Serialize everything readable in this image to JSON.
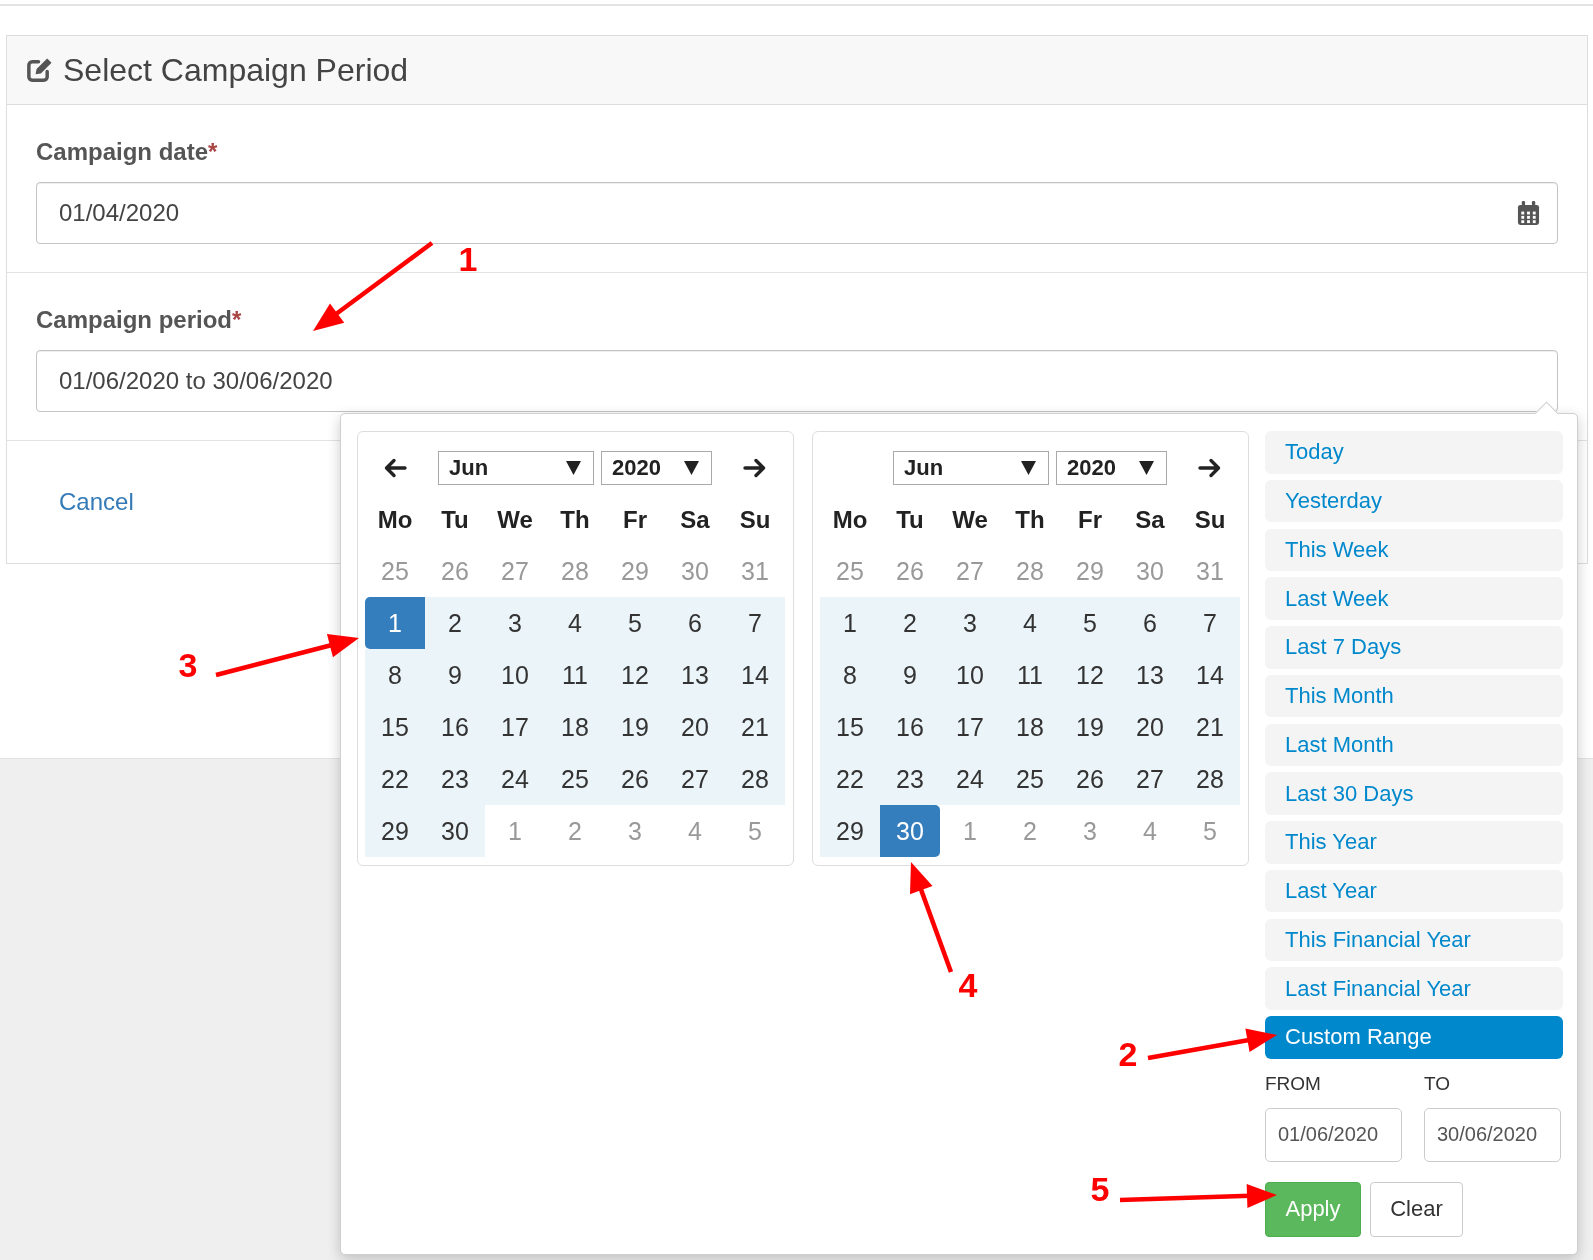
{
  "panel": {
    "title": "Select Campaign Period",
    "fields": [
      {
        "label": "Campaign date",
        "required_mark": "*",
        "value": "01/04/2020",
        "calendar_icon": true
      },
      {
        "label": "Campaign period",
        "required_mark": "*",
        "value": "01/06/2020 to 30/06/2020",
        "calendar_icon": false
      }
    ],
    "cancel": "Cancel"
  },
  "date_range_picker": {
    "calendars": [
      {
        "month": "Jun",
        "year": "2020",
        "show_previous": true,
        "show_next": true,
        "weekdays": [
          "Mo",
          "Tu",
          "We",
          "Th",
          "Fr",
          "Sa",
          "Su"
        ],
        "days": [
          {
            "day": "25",
            "off": true,
            "in_range": false,
            "selected": false
          },
          {
            "day": "26",
            "off": true,
            "in_range": false,
            "selected": false
          },
          {
            "day": "27",
            "off": true,
            "in_range": false,
            "selected": false
          },
          {
            "day": "28",
            "off": true,
            "in_range": false,
            "selected": false
          },
          {
            "day": "29",
            "off": true,
            "in_range": false,
            "selected": false
          },
          {
            "day": "30",
            "off": true,
            "in_range": false,
            "selected": false
          },
          {
            "day": "31",
            "off": true,
            "in_range": false,
            "selected": false
          },
          {
            "day": "1",
            "off": false,
            "in_range": true,
            "selected": true
          },
          {
            "day": "2",
            "off": false,
            "in_range": true,
            "selected": false
          },
          {
            "day": "3",
            "off": false,
            "in_range": true,
            "selected": false
          },
          {
            "day": "4",
            "off": false,
            "in_range": true,
            "selected": false
          },
          {
            "day": "5",
            "off": false,
            "in_range": true,
            "selected": false
          },
          {
            "day": "6",
            "off": false,
            "in_range": true,
            "selected": false
          },
          {
            "day": "7",
            "off": false,
            "in_range": true,
            "selected": false
          },
          {
            "day": "8",
            "off": false,
            "in_range": true,
            "selected": false
          },
          {
            "day": "9",
            "off": false,
            "in_range": true,
            "selected": false
          },
          {
            "day": "10",
            "off": false,
            "in_range": true,
            "selected": false
          },
          {
            "day": "11",
            "off": false,
            "in_range": true,
            "selected": false
          },
          {
            "day": "12",
            "off": false,
            "in_range": true,
            "selected": false
          },
          {
            "day": "13",
            "off": false,
            "in_range": true,
            "selected": false
          },
          {
            "day": "14",
            "off": false,
            "in_range": true,
            "selected": false
          },
          {
            "day": "15",
            "off": false,
            "in_range": true,
            "selected": false
          },
          {
            "day": "16",
            "off": false,
            "in_range": true,
            "selected": false
          },
          {
            "day": "17",
            "off": false,
            "in_range": true,
            "selected": false
          },
          {
            "day": "18",
            "off": false,
            "in_range": true,
            "selected": false
          },
          {
            "day": "19",
            "off": false,
            "in_range": true,
            "selected": false
          },
          {
            "day": "20",
            "off": false,
            "in_range": true,
            "selected": false
          },
          {
            "day": "21",
            "off": false,
            "in_range": true,
            "selected": false
          },
          {
            "day": "22",
            "off": false,
            "in_range": true,
            "selected": false
          },
          {
            "day": "23",
            "off": false,
            "in_range": true,
            "selected": false
          },
          {
            "day": "24",
            "off": false,
            "in_range": true,
            "selected": false
          },
          {
            "day": "25",
            "off": false,
            "in_range": true,
            "selected": false
          },
          {
            "day": "26",
            "off": false,
            "in_range": true,
            "selected": false
          },
          {
            "day": "27",
            "off": false,
            "in_range": true,
            "selected": false
          },
          {
            "day": "28",
            "off": false,
            "in_range": true,
            "selected": false
          },
          {
            "day": "29",
            "off": false,
            "in_range": true,
            "selected": false
          },
          {
            "day": "30",
            "off": false,
            "in_range": true,
            "selected": false
          },
          {
            "day": "1",
            "off": true,
            "in_range": false,
            "selected": false
          },
          {
            "day": "2",
            "off": true,
            "in_range": false,
            "selected": false
          },
          {
            "day": "3",
            "off": true,
            "in_range": false,
            "selected": false
          },
          {
            "day": "4",
            "off": true,
            "in_range": false,
            "selected": false
          },
          {
            "day": "5",
            "off": true,
            "in_range": false,
            "selected": false
          }
        ]
      },
      {
        "month": "Jun",
        "year": "2020",
        "show_previous": false,
        "show_next": true,
        "weekdays": [
          "Mo",
          "Tu",
          "We",
          "Th",
          "Fr",
          "Sa",
          "Su"
        ],
        "days": [
          {
            "day": "25",
            "off": true,
            "in_range": false,
            "selected": false
          },
          {
            "day": "26",
            "off": true,
            "in_range": false,
            "selected": false
          },
          {
            "day": "27",
            "off": true,
            "in_range": false,
            "selected": false
          },
          {
            "day": "28",
            "off": true,
            "in_range": false,
            "selected": false
          },
          {
            "day": "29",
            "off": true,
            "in_range": false,
            "selected": false
          },
          {
            "day": "30",
            "off": true,
            "in_range": false,
            "selected": false
          },
          {
            "day": "31",
            "off": true,
            "in_range": false,
            "selected": false
          },
          {
            "day": "1",
            "off": false,
            "in_range": true,
            "selected": false
          },
          {
            "day": "2",
            "off": false,
            "in_range": true,
            "selected": false
          },
          {
            "day": "3",
            "off": false,
            "in_range": true,
            "selected": false
          },
          {
            "day": "4",
            "off": false,
            "in_range": true,
            "selected": false
          },
          {
            "day": "5",
            "off": false,
            "in_range": true,
            "selected": false
          },
          {
            "day": "6",
            "off": false,
            "in_range": true,
            "selected": false
          },
          {
            "day": "7",
            "off": false,
            "in_range": true,
            "selected": false
          },
          {
            "day": "8",
            "off": false,
            "in_range": true,
            "selected": false
          },
          {
            "day": "9",
            "off": false,
            "in_range": true,
            "selected": false
          },
          {
            "day": "10",
            "off": false,
            "in_range": true,
            "selected": false
          },
          {
            "day": "11",
            "off": false,
            "in_range": true,
            "selected": false
          },
          {
            "day": "12",
            "off": false,
            "in_range": true,
            "selected": false
          },
          {
            "day": "13",
            "off": false,
            "in_range": true,
            "selected": false
          },
          {
            "day": "14",
            "off": false,
            "in_range": true,
            "selected": false
          },
          {
            "day": "15",
            "off": false,
            "in_range": true,
            "selected": false
          },
          {
            "day": "16",
            "off": false,
            "in_range": true,
            "selected": false
          },
          {
            "day": "17",
            "off": false,
            "in_range": true,
            "selected": false
          },
          {
            "day": "18",
            "off": false,
            "in_range": true,
            "selected": false
          },
          {
            "day": "19",
            "off": false,
            "in_range": true,
            "selected": false
          },
          {
            "day": "20",
            "off": false,
            "in_range": true,
            "selected": false
          },
          {
            "day": "21",
            "off": false,
            "in_range": true,
            "selected": false
          },
          {
            "day": "22",
            "off": false,
            "in_range": true,
            "selected": false
          },
          {
            "day": "23",
            "off": false,
            "in_range": true,
            "selected": false
          },
          {
            "day": "24",
            "off": false,
            "in_range": true,
            "selected": false
          },
          {
            "day": "25",
            "off": false,
            "in_range": true,
            "selected": false
          },
          {
            "day": "26",
            "off": false,
            "in_range": true,
            "selected": false
          },
          {
            "day": "27",
            "off": false,
            "in_range": true,
            "selected": false
          },
          {
            "day": "28",
            "off": false,
            "in_range": true,
            "selected": false
          },
          {
            "day": "29",
            "off": false,
            "in_range": true,
            "selected": false
          },
          {
            "day": "30",
            "off": false,
            "in_range": true,
            "selected": true
          },
          {
            "day": "1",
            "off": true,
            "in_range": false,
            "selected": false
          },
          {
            "day": "2",
            "off": true,
            "in_range": false,
            "selected": false
          },
          {
            "day": "3",
            "off": true,
            "in_range": false,
            "selected": false
          },
          {
            "day": "4",
            "off": true,
            "in_range": false,
            "selected": false
          },
          {
            "day": "5",
            "off": true,
            "in_range": false,
            "selected": false
          }
        ]
      }
    ],
    "ranges": [
      {
        "label": "Today",
        "selected": false
      },
      {
        "label": "Yesterday",
        "selected": false
      },
      {
        "label": "This Week",
        "selected": false
      },
      {
        "label": "Last Week",
        "selected": false
      },
      {
        "label": "Last 7 Days",
        "selected": false
      },
      {
        "label": "This Month",
        "selected": false
      },
      {
        "label": "Last Month",
        "selected": false
      },
      {
        "label": "Last 30 Days",
        "selected": false
      },
      {
        "label": "This Year",
        "selected": false
      },
      {
        "label": "Last Year",
        "selected": false
      },
      {
        "label": "This Financial Year",
        "selected": false
      },
      {
        "label": "Last Financial Year",
        "selected": false
      },
      {
        "label": "Custom Range",
        "selected": true
      }
    ],
    "from_label": "FROM",
    "to_label": "TO",
    "from_value": "01/06/2020",
    "to_value": "30/06/2020",
    "apply": "Apply",
    "clear": "Clear"
  },
  "annotations": [
    {
      "label": "1"
    },
    {
      "label": "2"
    },
    {
      "label": "3"
    },
    {
      "label": "4"
    },
    {
      "label": "5"
    }
  ]
}
